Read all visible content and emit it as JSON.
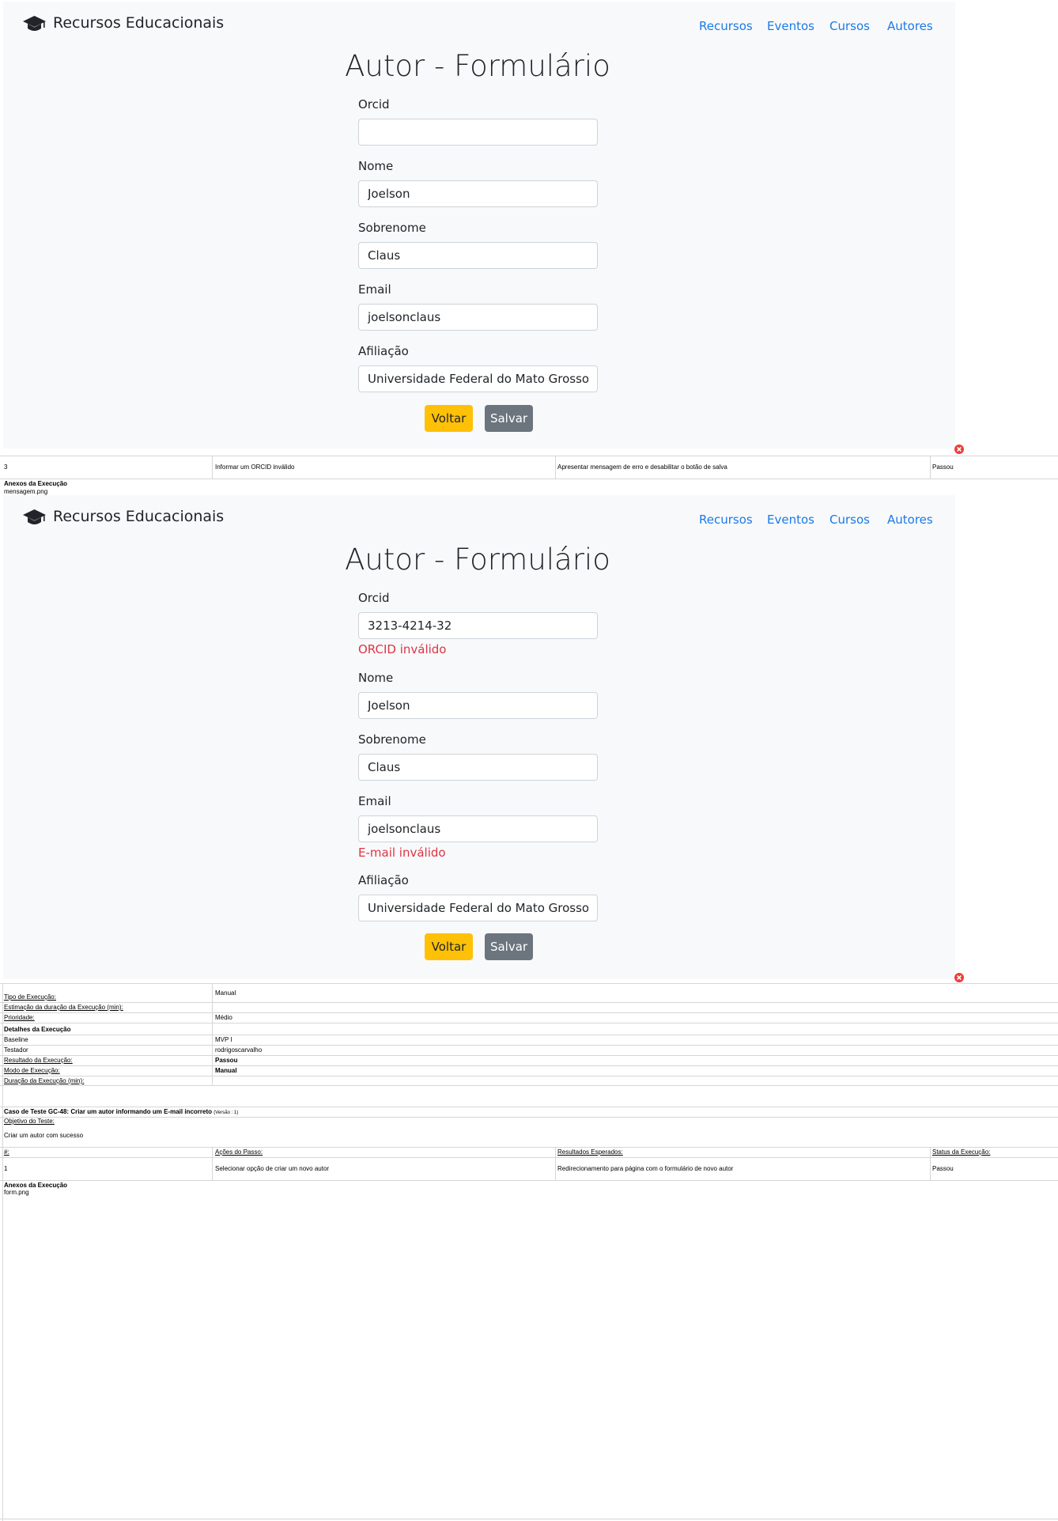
{
  "navbar": {
    "brand": "Recursos Educacionais",
    "brand_icon": "graduation-cap-icon",
    "links": [
      "Recursos",
      "Eventos",
      "Cursos",
      "Autores"
    ]
  },
  "screenshot1": {
    "title": "Autor - Formulário",
    "fields": [
      {
        "label": "Orcid",
        "value": ""
      },
      {
        "label": "Nome",
        "value": "Joelson"
      },
      {
        "label": "Sobrenome",
        "value": "Claus"
      },
      {
        "label": "Email",
        "value": "joelsonclaus"
      },
      {
        "label": "Afiliação",
        "value": "Universidade Federal do Mato Grosso"
      }
    ],
    "back_label": "Voltar",
    "save_label": "Salvar"
  },
  "step3": {
    "number": "3",
    "action": "Informar um ORCID inválido",
    "expected": "Apresentar mensagem de erro e desabilitar o botão de salva",
    "status": "Passou"
  },
  "attachments1": {
    "heading": "Anexos da Execução",
    "file": "mensagem.png"
  },
  "screenshot2": {
    "title": "Autor - Formulário",
    "fields": [
      {
        "label": "Orcid",
        "value": "3213-4214-32",
        "error": "ORCID inválido"
      },
      {
        "label": "Nome",
        "value": "Joelson"
      },
      {
        "label": "Sobrenome",
        "value": "Claus"
      },
      {
        "label": "Email",
        "value": "joelsonclaus",
        "error": "E-mail inválido"
      },
      {
        "label": "Afiliação",
        "value": "Universidade Federal do Mato Grosso"
      }
    ],
    "back_label": "Voltar",
    "save_label": "Salvar"
  },
  "execution_info": {
    "tipo_label": "Tipo de Execução:",
    "tipo_value": "Manual",
    "estimativa_label": "Estimação da duração da Execução (min):",
    "prioridade_label": "Prioridade:",
    "prioridade_value": "Médio",
    "details_heading": "Detalhes da Execução",
    "baseline_label": "Baseline",
    "baseline_value": "MVP I",
    "testador_label": "Testador",
    "testador_value": "rodrigoscarvalho",
    "resultado_label": "Resultado da Execução:",
    "resultado_value": "Passou",
    "modo_label": "Modo de Execução:",
    "modo_value": "Manual",
    "duracao_label": "Duração da Execução (min):"
  },
  "test_case": {
    "title": "Caso de Teste GC-48: Criar um autor informando um E-mail incorreto",
    "version": "(Versão : 1)",
    "objective_label": "Objetivo do Teste:",
    "objective": "Criar um autor com sucesso",
    "columns": [
      "#:",
      "Ações do Passo:",
      "Resultados Esperados:",
      "Status da Execução:"
    ],
    "rows": [
      {
        "number": "1",
        "action": "Selecionar opção de criar um novo autor",
        "expected": "Redirecionamento para página com o formulário de novo autor",
        "status": "Passou"
      }
    ]
  },
  "attachments2": {
    "heading": "Anexos da Execução",
    "file": "form.png"
  },
  "colors": {
    "primary_link": "#1a7ae8",
    "warning": "#ffc107",
    "secondary": "#6c757d",
    "danger": "#dc3545",
    "panel_bg": "#f8f9fa"
  }
}
